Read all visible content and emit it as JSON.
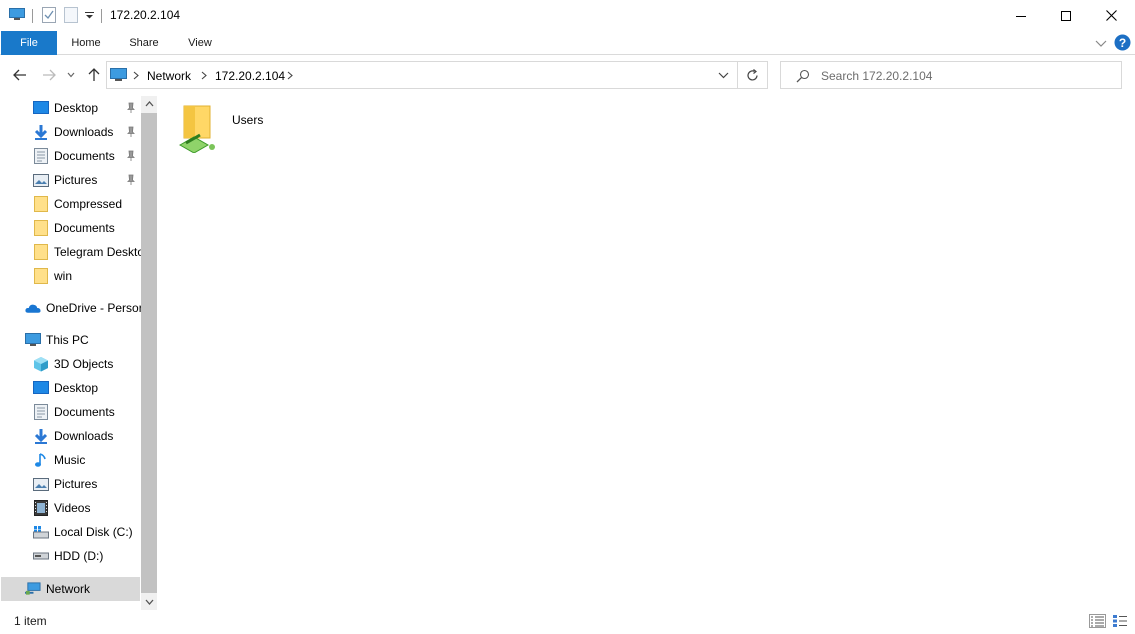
{
  "window": {
    "title": "172.20.2.104",
    "buttons": {
      "minimize": "minimize",
      "maximize": "maximize",
      "close": "close"
    }
  },
  "ribbon": {
    "tabs": [
      {
        "label": "File",
        "active": true
      },
      {
        "label": "Home"
      },
      {
        "label": "Share"
      },
      {
        "label": "View"
      }
    ]
  },
  "address": {
    "breadcrumbs": [
      "Network",
      "172.20.2.104"
    ]
  },
  "search": {
    "placeholder": "Search 172.20.2.104"
  },
  "nav": {
    "quick_access": [
      {
        "label": "Desktop",
        "icon": "desktop-icon",
        "pinned": true
      },
      {
        "label": "Downloads",
        "icon": "downloads-icon",
        "pinned": true
      },
      {
        "label": "Documents",
        "icon": "documents-icon",
        "pinned": true
      },
      {
        "label": "Pictures",
        "icon": "pictures-icon",
        "pinned": true
      },
      {
        "label": "Compressed",
        "icon": "folder-icon",
        "pinned": false
      },
      {
        "label": "Documents",
        "icon": "folder-icon",
        "pinned": false
      },
      {
        "label": "Telegram Deskto",
        "icon": "folder-icon",
        "pinned": false
      },
      {
        "label": "win",
        "icon": "folder-icon",
        "pinned": false
      }
    ],
    "onedrive": {
      "label": "OneDrive - Persor",
      "icon": "onedrive-icon"
    },
    "this_pc": {
      "label": "This PC",
      "icon": "this-pc-icon",
      "items": [
        {
          "label": "3D Objects",
          "icon": "3d-objects-icon"
        },
        {
          "label": "Desktop",
          "icon": "desktop-icon"
        },
        {
          "label": "Documents",
          "icon": "documents-icon"
        },
        {
          "label": "Downloads",
          "icon": "downloads-icon"
        },
        {
          "label": "Music",
          "icon": "music-icon"
        },
        {
          "label": "Pictures",
          "icon": "pictures-icon"
        },
        {
          "label": "Videos",
          "icon": "videos-icon"
        },
        {
          "label": "Local Disk (C:)",
          "icon": "local-disk-icon"
        },
        {
          "label": "HDD (D:)",
          "icon": "hdd-icon"
        }
      ]
    },
    "network": {
      "label": "Network",
      "icon": "network-icon",
      "selected": true
    }
  },
  "content": {
    "items": [
      {
        "label": "Users",
        "icon": "shared-folder-icon"
      }
    ]
  },
  "status": {
    "item_count": "1 item"
  },
  "colors": {
    "accent": "#1979ca",
    "selected_bg": "#d9d9d9",
    "help": "#1c6fc4"
  }
}
